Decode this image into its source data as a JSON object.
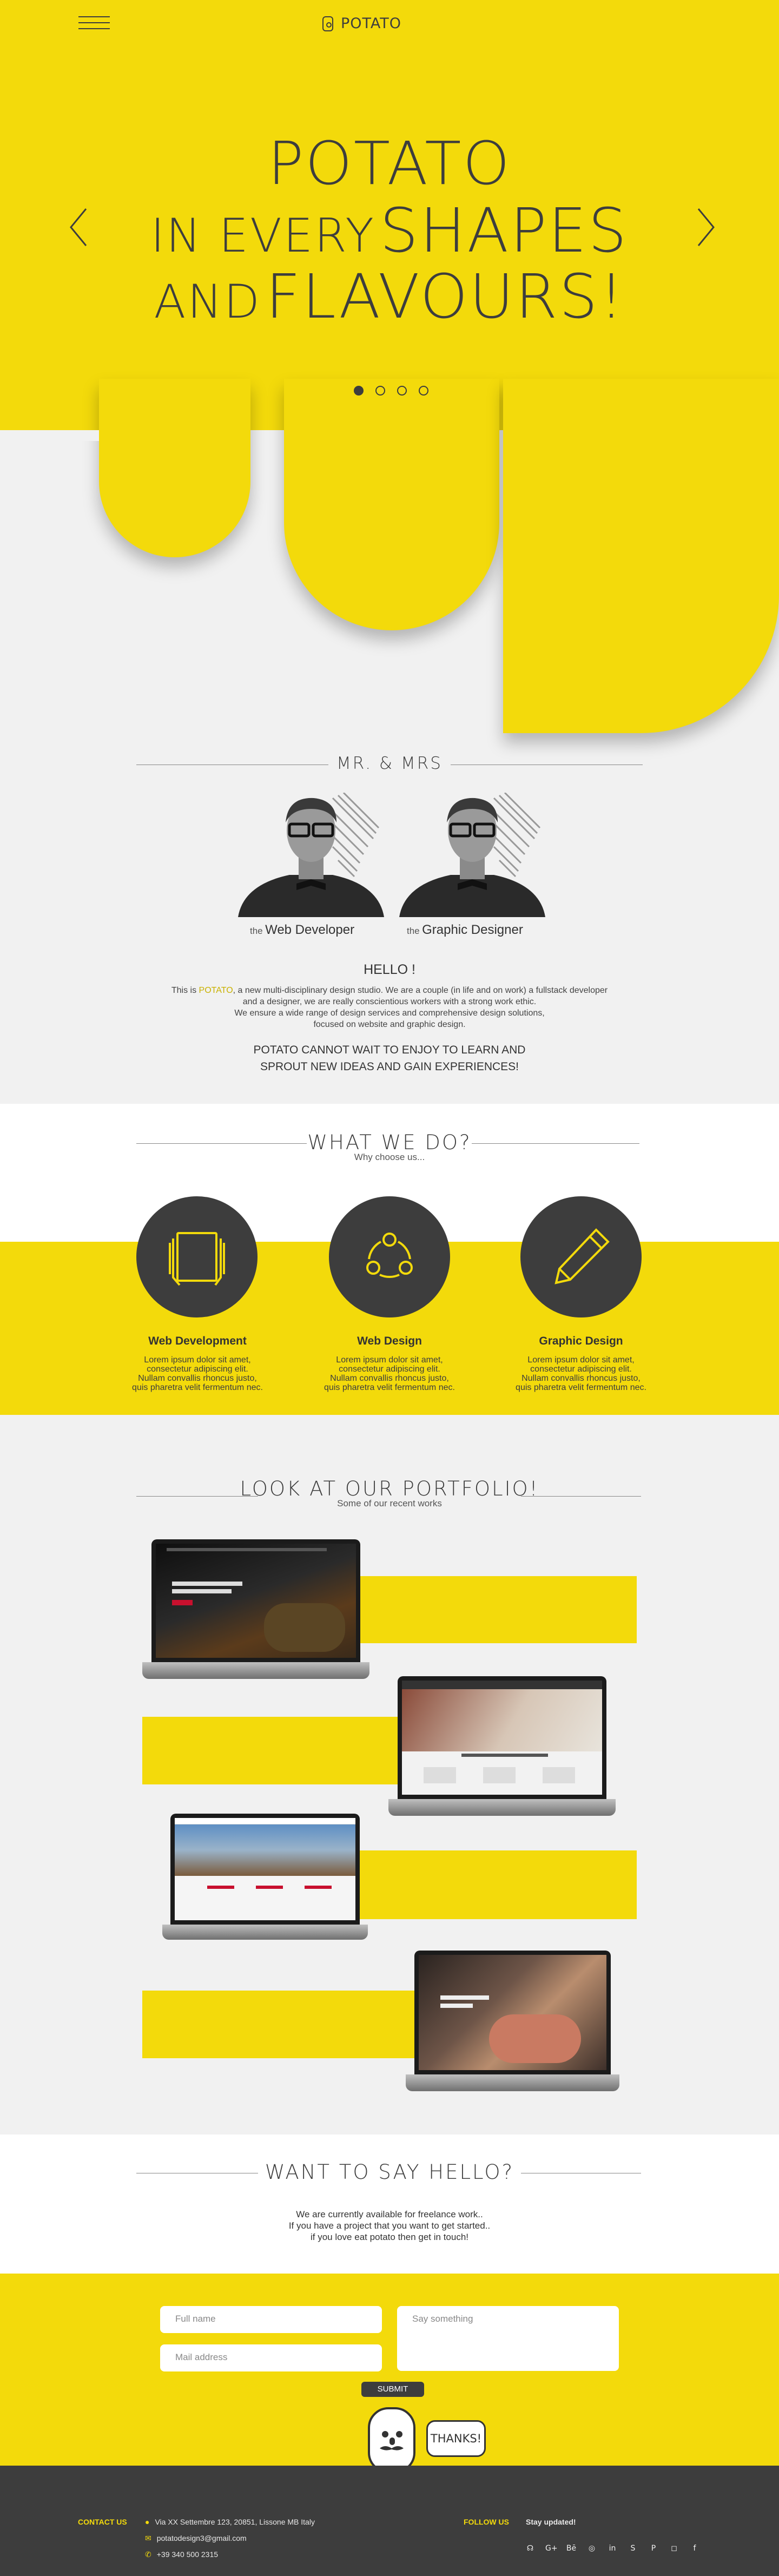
{
  "header": {
    "logo_text": "POTATO"
  },
  "hero": {
    "line1": "POTATO",
    "line2a": "IN EVERY",
    "line2b": "SHAPES",
    "line3a": "AND",
    "line3b": "FLAVOURS!",
    "slides_total": 4,
    "slide_active": 1
  },
  "team": {
    "title": "MR. & MRS",
    "members": [
      {
        "prefix": "the",
        "role": "Web Developer"
      },
      {
        "prefix": "the",
        "role": "Graphic Designer"
      }
    ],
    "hello": "HELLO !",
    "intro_a": "This is ",
    "intro_brand": "POTATO",
    "intro_b": ", a new multi-disciplinary design studio. We are a couple (in life and on work) a fullstack developer",
    "intro_line2": "and a designer, we are really conscientious workers with a strong work ethic.",
    "intro_line3": "We ensure a wide range of design services and comprehensive design solutions,",
    "intro_line4": "focused on website and graphic design.",
    "motto_line1": "POTATO CANNOT WAIT TO ENJOY TO LEARN AND",
    "motto_line2": "SPROUT NEW IDEAS AND GAIN EXPERIENCES!"
  },
  "services": {
    "title": "WHAT WE DO?",
    "subtitle": "Why choose us...",
    "items": [
      {
        "icon": "layers-icon",
        "title": "Web Development",
        "l1": "Lorem ipsum dolor sit amet,",
        "l2": "consectetur adipiscing elit.",
        "l3": "Nullam convallis rhoncus justo,",
        "l4": "quis pharetra velit fermentum nec."
      },
      {
        "icon": "share-nodes-icon",
        "title": "Web Design",
        "l1": "Lorem ipsum dolor sit amet,",
        "l2": "consectetur adipiscing elit.",
        "l3": "Nullam convallis rhoncus justo,",
        "l4": "quis pharetra velit fermentum nec."
      },
      {
        "icon": "pencil-icon",
        "title": "Graphic Design",
        "l1": "Lorem ipsum dolor sit amet,",
        "l2": "consectetur adipiscing elit.",
        "l3": "Nullam convallis rhoncus justo,",
        "l4": "quis pharetra velit fermentum nec."
      }
    ]
  },
  "portfolio": {
    "title": "LOOK AT OUR PORTFOLIO!",
    "subtitle": "Some of our recent works"
  },
  "contact": {
    "title": "WANT TO SAY HELLO?",
    "line1": "We are currently available for freelance work..",
    "line2": "If you have a project that you want to get started..",
    "line3": "if you love eat potato then get in touch!",
    "name_placeholder": "Full name",
    "mail_placeholder": "Mail address",
    "message_placeholder": "Say something",
    "submit_label": "SUBMIT",
    "bubble": "THANKS!"
  },
  "footer": {
    "contact_label": "CONTACT US",
    "address": "Via XX Settembre 123, 20851, Lissone MB Italy",
    "email": "potatodesign3@gmail.com",
    "phone": "+39 340 500 2315",
    "follow_label": "FOLLOW US",
    "stay": "Stay updated!",
    "socials": [
      "rss-icon",
      "google-plus-icon",
      "behance-icon",
      "whatsapp-icon",
      "linkedin-icon",
      "skype-icon",
      "pinterest-icon",
      "instagram-icon",
      "facebook-icon"
    ]
  },
  "colors": {
    "accent": "#f3da0b",
    "dark": "#3d3d3d",
    "light": "#f1f1f1"
  }
}
